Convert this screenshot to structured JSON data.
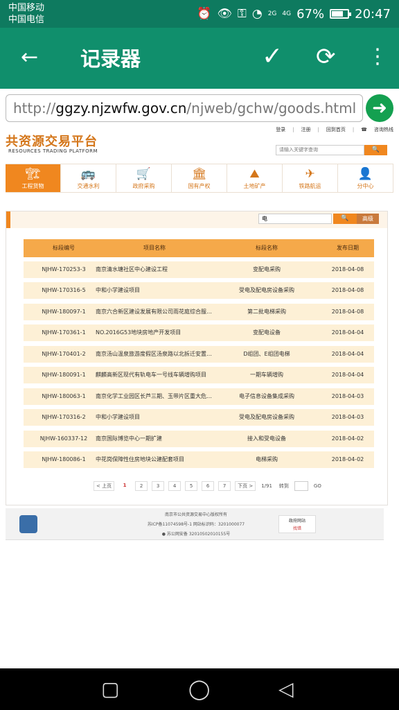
{
  "status": {
    "carrier1": "中国移动",
    "carrier2": "中国电信",
    "net1": "2G",
    "net2": "4G",
    "battery": "67%",
    "time": "20:47"
  },
  "appbar": {
    "title": "记录器"
  },
  "urlbar": {
    "host": "ggzy.njzwfw.gov.cn",
    "path": "/njweb/gchw/goods.html",
    "prefix": "http://"
  },
  "site": {
    "logo_cn": "共资源交易平台",
    "logo_en": "RESOURCES TRADING PLATFORM",
    "links": [
      "登录",
      "注册",
      "回到首页",
      "咨询热线"
    ],
    "search_placeholder": "请输入关键字查询"
  },
  "nav": [
    {
      "label": "工程货物",
      "icon": "crane-icon"
    },
    {
      "label": "交通水利",
      "icon": "bus-icon"
    },
    {
      "label": "政府采购",
      "icon": "cart-icon"
    },
    {
      "label": "国有产权",
      "icon": "building-icon"
    },
    {
      "label": "土地矿产",
      "icon": "mountain-icon"
    },
    {
      "label": "铁路航运",
      "icon": "plane-icon"
    },
    {
      "label": "分中心",
      "icon": "person-icon"
    }
  ],
  "filter": {
    "value": "电",
    "adv_label": "高级"
  },
  "table": {
    "headers": [
      "标段编号",
      "项目名称",
      "标段名称",
      "发布日期"
    ],
    "rows": [
      [
        "NJHW-170253-3",
        "南京清水塘社区中心建设工程",
        "变配电采购",
        "2018-04-08"
      ],
      [
        "NJHW-170316-5",
        "中和小学建设项目",
        "受电及配电房设备采购",
        "2018-04-08"
      ],
      [
        "NJHW-180097-1",
        "南京六合新区建设发展有限公司雨花庭综合服…",
        "第二批电梯采购",
        "2018-04-08"
      ],
      [
        "NJHW-170361-1",
        "NO.2016G53地块房地产开发项目",
        "变配电设备",
        "2018-04-04"
      ],
      [
        "NJHW-170401-2",
        "南京汤山温泉旅游度假区汤泉路以北拆迁安置…",
        "D组团、E组团电梯",
        "2018-04-04"
      ],
      [
        "NJHW-180091-1",
        "麒麟高新区现代有轨电车一号线车辆增购项目",
        "一期车辆增购",
        "2018-04-04"
      ],
      [
        "NJHW-180063-1",
        "南京化学工业园区长芦三期、玉带片区重大危…",
        "电子信息设备集成采购",
        "2018-04-03"
      ],
      [
        "NJHW-170316-2",
        "中和小学建设项目",
        "受电及配电房设备采购",
        "2018-04-03"
      ],
      [
        "NJHW-160337-12",
        "南京国际博览中心一期扩建",
        "接入和受电设备",
        "2018-04-02"
      ],
      [
        "NJHW-180086-1",
        "中花岗保障性住房地块公建配套项目",
        "电梯采购",
        "2018-04-02"
      ]
    ]
  },
  "pager": {
    "prev": "< 上页",
    "pages": [
      "1",
      "2",
      "3",
      "4",
      "5",
      "6",
      "7"
    ],
    "next": "下页 >",
    "info": "1/91",
    "goto_label": "转到",
    "go": "GO"
  },
  "footer": {
    "line1": "南京市公共资源交易中心版权所有",
    "line2": "苏ICP备11074598号-1 网站标识码：3201000077",
    "line3": "苏公网安备 32010502010155号",
    "badge_top": "政府网站",
    "badge_bottom": "找错"
  }
}
